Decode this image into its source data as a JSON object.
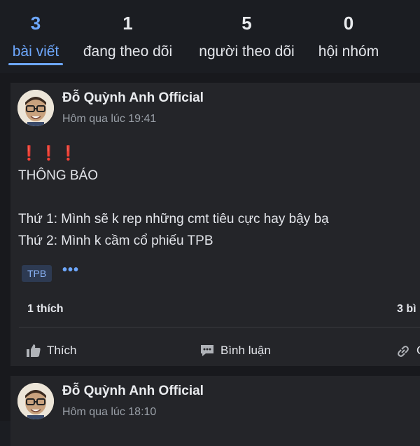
{
  "stats": [
    {
      "value": "3",
      "label": "bài viết",
      "active": true
    },
    {
      "value": "1",
      "label": "đang theo dõi",
      "active": false
    },
    {
      "value": "5",
      "label": "người theo dõi",
      "active": false
    },
    {
      "value": "0",
      "label": "hội nhóm",
      "active": false
    }
  ],
  "posts": [
    {
      "author": "Đỗ Quỳnh Anh Official",
      "time": "Hôm qua lúc 19:41",
      "alerts": [
        "❗",
        "❗",
        "❗"
      ],
      "lines": [
        "THÔNG BÁO",
        "Thứ 1: Mình sẽ k rep những cmt tiêu cực hay bậy bạ",
        "Thứ 2: Mình k cầm cổ phiếu TPB"
      ],
      "tag": "TPB",
      "more": "•••",
      "likes": "1 thích",
      "shares": "3 bì",
      "actions": {
        "like": "Thích",
        "comment": "Bình luận",
        "share": "C"
      }
    },
    {
      "author": "Đỗ Quỳnh Anh Official",
      "time": "Hôm qua lúc 18:10"
    }
  ],
  "colors": {
    "accent": "#6ea8fe",
    "alert": "#e53e3e",
    "card": "#242529",
    "background": "#18191d"
  }
}
